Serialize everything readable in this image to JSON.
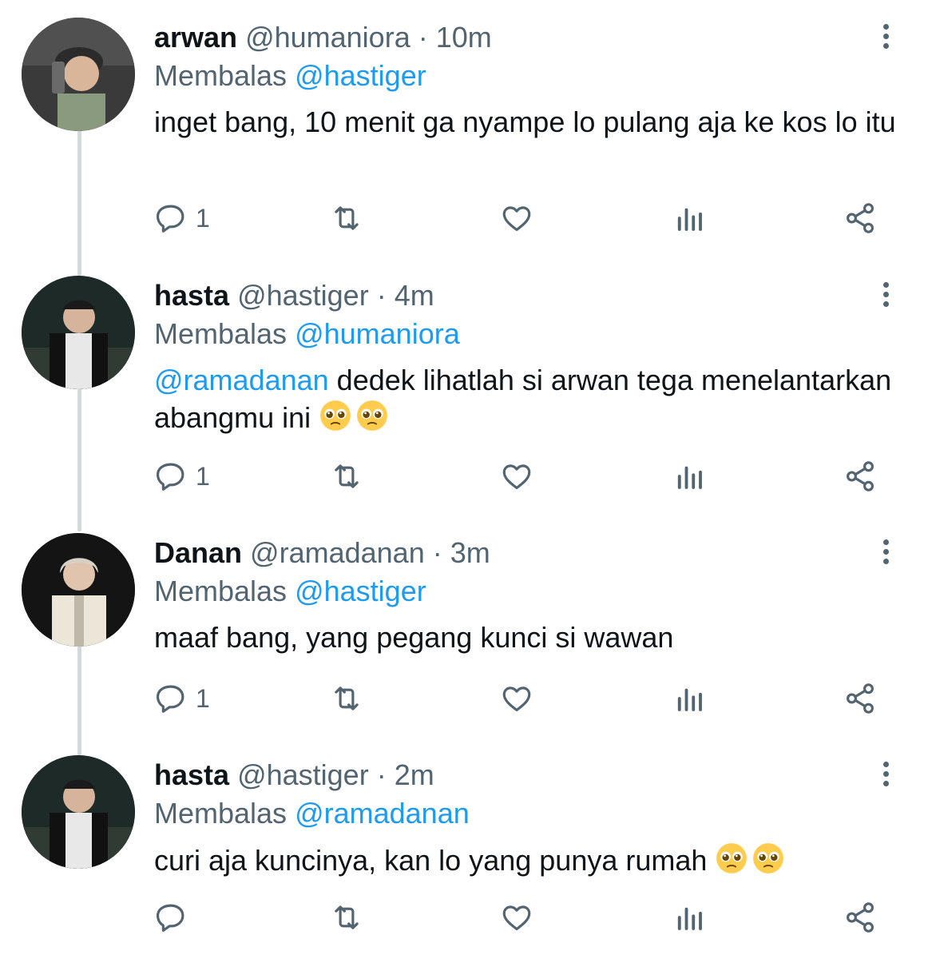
{
  "tweets": [
    {
      "name": "arwan",
      "handle": "@humaniora",
      "time": "10m",
      "reply_label": "Membalas",
      "reply_to": "@hastiger",
      "mention": "",
      "text": "inget bang, 10 menit ga nyampe lo pulang aja ke kos lo itu",
      "emojis": [],
      "reply_count": "1"
    },
    {
      "name": "hasta",
      "handle": "@hastiger",
      "time": "4m",
      "reply_label": "Membalas",
      "reply_to": "@humaniora",
      "mention": "@ramadanan",
      "text": " dedek lihatlah si arwan tega menelantarkan abangmu ini ",
      "emojis": [
        "pleading-face",
        "pleading-face"
      ],
      "reply_count": "1"
    },
    {
      "name": "Danan",
      "handle": "@ramadanan",
      "time": "3m",
      "reply_label": "Membalas",
      "reply_to": "@hastiger",
      "mention": "",
      "text": "maaf bang, yang pegang kunci si wawan",
      "emojis": [],
      "reply_count": "1"
    },
    {
      "name": "hasta",
      "handle": "@hastiger",
      "time": "2m",
      "reply_label": "Membalas",
      "reply_to": "@ramadanan",
      "mention": "",
      "text": "curi aja kuncinya, kan lo yang punya rumah ",
      "emojis": [
        "pleading-face",
        "pleading-face"
      ],
      "reply_count": ""
    }
  ],
  "separator": "·",
  "icons": {
    "reply": "reply-icon",
    "retweet": "retweet-icon",
    "like": "heart-icon",
    "views": "analytics-icon",
    "share": "share-icon",
    "more": "more-vertical-icon"
  },
  "colors": {
    "link": "#1d9bf0",
    "muted": "#536471",
    "text": "#0f1419",
    "thread_line": "#cfd9de"
  }
}
